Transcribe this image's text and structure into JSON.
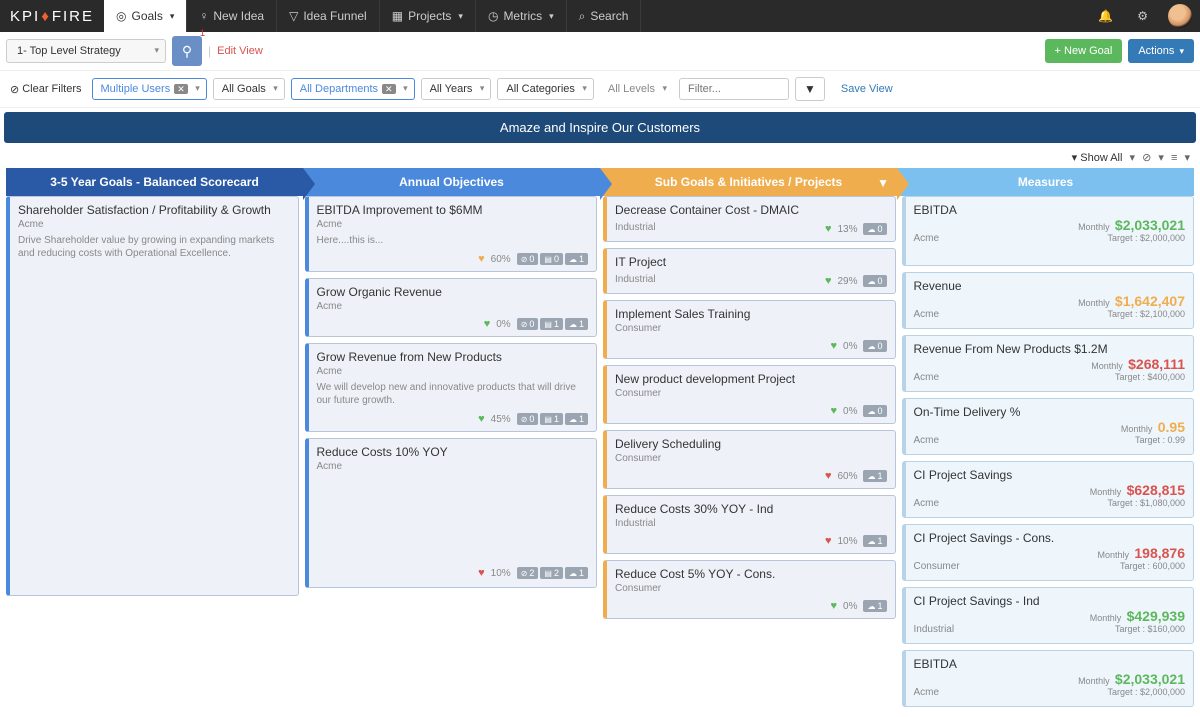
{
  "logo": {
    "part1": "KPI",
    "part2": "FIRE"
  },
  "nav": {
    "goals": "Goals",
    "newIdea": "New Idea",
    "ideaFunnel": "Idea Funnel",
    "projects": "Projects",
    "metrics": "Metrics",
    "search": "Search"
  },
  "subbar": {
    "strategySelect": "1- Top Level Strategy",
    "badge": "1",
    "editView": "Edit View",
    "newGoal": "+ New Goal",
    "actions": "Actions"
  },
  "filters": {
    "clear": "Clear Filters",
    "users": "Multiple Users",
    "goals": "All Goals",
    "departments": "All Departments",
    "years": "All Years",
    "categories": "All Categories",
    "levels": "All Levels",
    "filterPlaceholder": "Filter...",
    "saveView": "Save View"
  },
  "banner": "Amaze and Inspire Our Customers",
  "showAll": "Show All",
  "headers": {
    "c1": "3-5 Year Goals - Balanced Scorecard",
    "c2": "Annual Objectives",
    "c3": "Sub Goals & Initiatives / Projects",
    "c4": "Measures"
  },
  "col1": {
    "card1": {
      "title": "Shareholder Satisfaction / Profitability & Growth",
      "sub": "Acme",
      "desc": "Drive Shareholder value by growing in expanding markets and reducing costs with Operational Excellence."
    }
  },
  "col2": {
    "c1": {
      "title": "EBITDA Improvement to $6MM",
      "sub": "Acme",
      "desc": "Here....this is...",
      "pct": "60%",
      "p1": "0",
      "p2": "0",
      "p3": "1"
    },
    "c2": {
      "title": "Grow Organic Revenue",
      "sub": "Acme",
      "pct": "0%",
      "p1": "0",
      "p2": "1",
      "p3": "1"
    },
    "c3": {
      "title": "Grow Revenue from New Products",
      "sub": "Acme",
      "desc": "We will develop new and innovative products that will drive our future growth.",
      "pct": "45%",
      "p1": "0",
      "p2": "1",
      "p3": "1"
    },
    "c4": {
      "title": "Reduce Costs 10% YOY",
      "sub": "Acme",
      "pct": "10%",
      "p1": "2",
      "p2": "2",
      "p3": "1"
    }
  },
  "col3": {
    "c1": {
      "title": "Decrease Container Cost - DMAIC",
      "sub": "Industrial",
      "pct": "13%",
      "p": "0"
    },
    "c2": {
      "title": "IT Project",
      "sub": "Industrial",
      "pct": "29%",
      "p": "0"
    },
    "c3": {
      "title": "Implement Sales Training",
      "sub": "Consumer",
      "pct": "0%",
      "p": "0"
    },
    "c4": {
      "title": "New product development Project",
      "sub": "Consumer",
      "pct": "0%",
      "p": "0"
    },
    "c5": {
      "title": "Delivery Scheduling",
      "sub": "Consumer",
      "pct": "60%",
      "p": "1"
    },
    "c6": {
      "title": "Reduce Costs 30% YOY - Ind",
      "sub": "Industrial",
      "pct": "10%",
      "p": "1"
    },
    "c7": {
      "title": "Reduce Cost 5% YOY - Cons.",
      "sub": "Consumer",
      "pct": "0%",
      "p": "1"
    }
  },
  "col4": {
    "m1": {
      "title": "EBITDA",
      "sub": "Acme",
      "freq": "Monthly",
      "val": "$2,033,021",
      "cls": "green",
      "target": "Target : $2,000,000"
    },
    "m2": {
      "title": "Revenue",
      "sub": "Acme",
      "freq": "Monthly",
      "val": "$1,642,407",
      "cls": "orange",
      "target": "Target : $2,100,000"
    },
    "m3": {
      "title": "Revenue From New Products $1.2M",
      "sub": "Acme",
      "freq": "Monthly",
      "val": "$268,111",
      "cls": "red",
      "target": "Target : $400,000"
    },
    "m4": {
      "title": "On-Time Delivery %",
      "sub": "Acme",
      "freq": "Monthly",
      "val": "0.95",
      "cls": "orange",
      "target": "Target : 0.99"
    },
    "m5": {
      "title": "CI Project Savings",
      "sub": "Acme",
      "freq": "Monthly",
      "val": "$628,815",
      "cls": "red",
      "target": "Target : $1,080,000"
    },
    "m6": {
      "title": "CI Project Savings - Cons.",
      "sub": "Consumer",
      "freq": "Monthly",
      "val": "198,876",
      "cls": "red",
      "target": "Target : 600,000"
    },
    "m7": {
      "title": "CI Project Savings - Ind",
      "sub": "Industrial",
      "freq": "Monthly",
      "val": "$429,939",
      "cls": "green",
      "target": "Target : $160,000"
    },
    "m8": {
      "title": "EBITDA",
      "sub": "Acme",
      "freq": "Monthly",
      "val": "$2,033,021",
      "cls": "green",
      "target": "Target : $2,000,000"
    }
  }
}
